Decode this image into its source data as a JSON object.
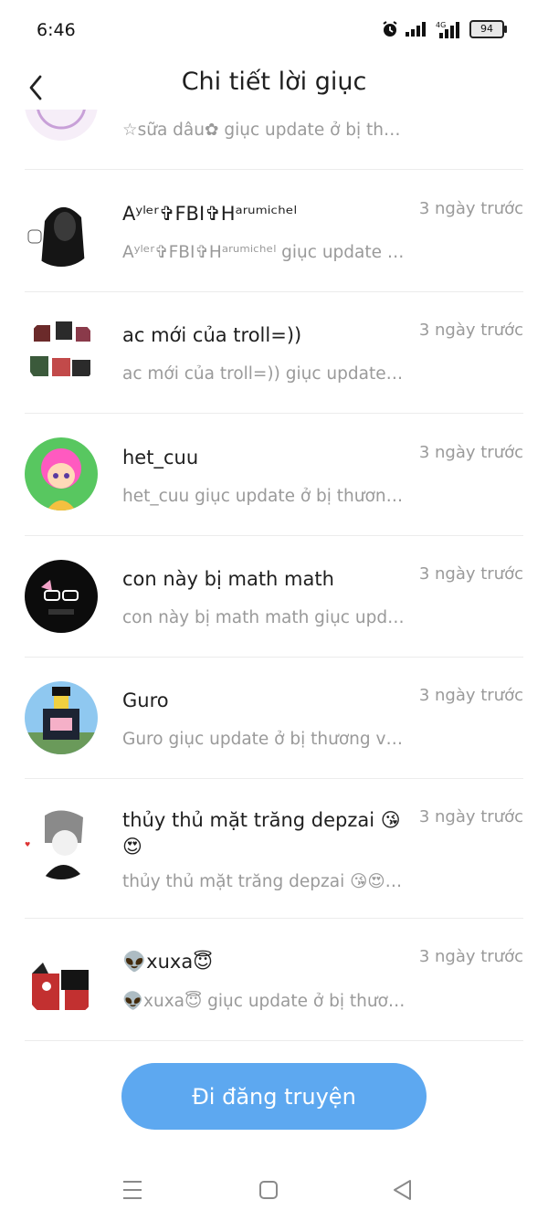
{
  "status_bar": {
    "time": "6:46",
    "network": "4G",
    "battery": "94"
  },
  "header": {
    "title": "Chi tiết lời giục"
  },
  "list": {
    "items": [
      {
        "name": "",
        "time": "",
        "preview": "☆sữa dâu✿ giục update ở bị thươ…"
      },
      {
        "name": "Aʸˡᵉʳ✞FBI✞Hᵃʳᵘᵐⁱᶜʰᵉˡ",
        "time": "3 ngày trước",
        "preview": "Aʸˡᵉʳ✞FBI✞Hᵃʳᵘᵐⁱᶜʰᵉˡ giục update ở …"
      },
      {
        "name": "ac mới của troll=))",
        "time": "3 ngày trước",
        "preview": "ac mới của troll=)) giục update ở …"
      },
      {
        "name": "het_cuu",
        "time": "3 ngày trước",
        "preview": "het_cuu giục update ở bị thương v…"
      },
      {
        "name": "con này bị math math",
        "time": "3 ngày trước",
        "preview": "con này bị math math giục update…"
      },
      {
        "name": "Guro",
        "time": "3 ngày trước",
        "preview": "Guro giục update ở bị thương và l…"
      },
      {
        "name": "thủy thủ mặt trăng depzai 😘😍",
        "time": "3 ngày trước",
        "preview": "thủy thủ mặt trăng depzai 😘😍 gi…"
      },
      {
        "name": "👽xuxa😇",
        "time": "3 ngày trước",
        "preview": "👽xuxa😇 giục update ở bị thươn…"
      }
    ]
  },
  "cta": {
    "label": "Đi đăng truyện"
  },
  "colors": {
    "accent": "#5da8f0",
    "muted_text": "#9a9a9a",
    "divider": "#ececec"
  }
}
